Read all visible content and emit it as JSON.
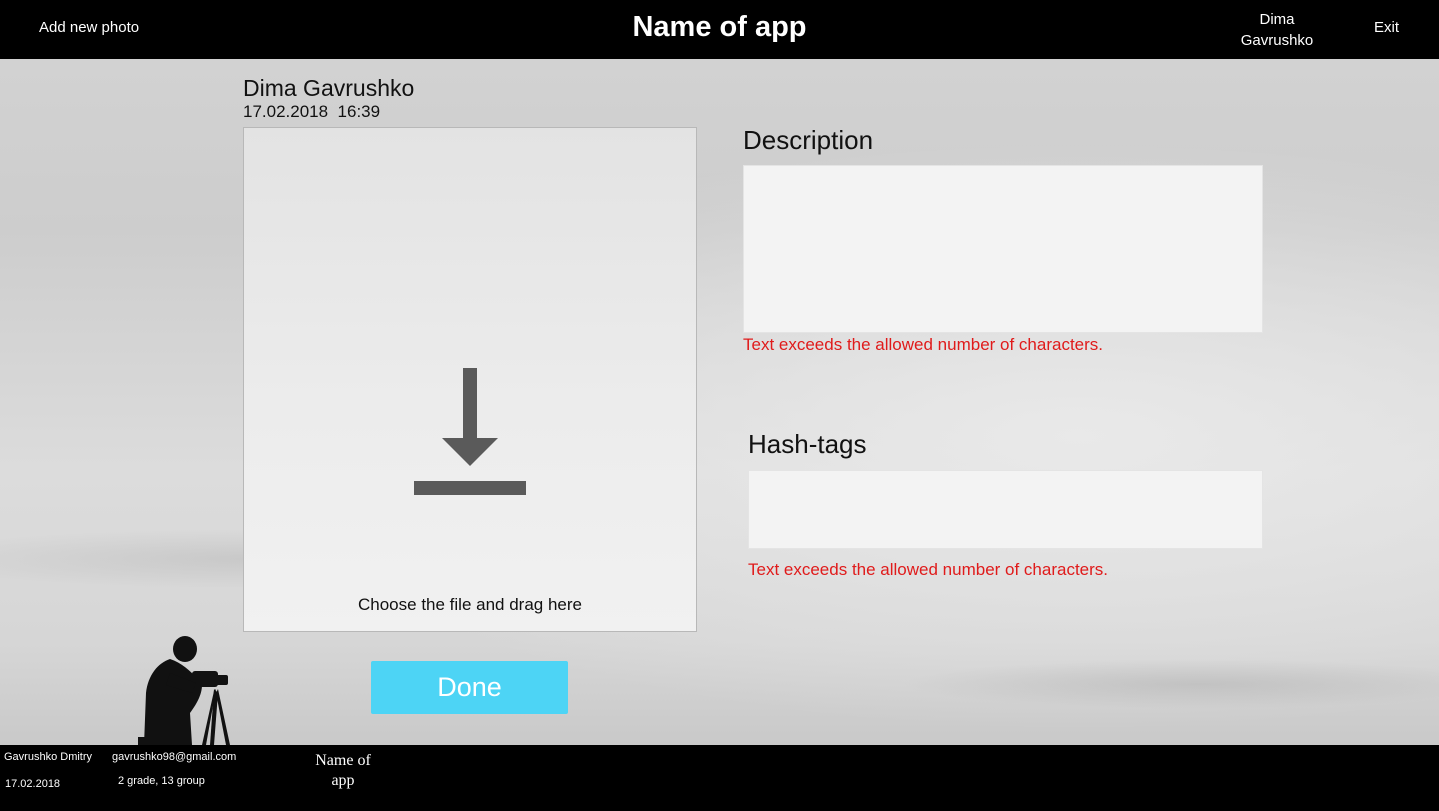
{
  "header": {
    "add_photo_label": "Add new photo",
    "app_title": "Name of app",
    "user_name_line1": "Dima",
    "user_name_line2": "Gavrushko",
    "exit_label": "Exit"
  },
  "post": {
    "author": "Dima Gavrushko",
    "date": "17.02.2018  16:39"
  },
  "upload": {
    "icon": "download-icon",
    "drop_label": "Choose the file and drag here"
  },
  "description": {
    "label": "Description",
    "value": "",
    "error": "Text exceeds the allowed number of characters."
  },
  "hashtags": {
    "label": "Hash-tags",
    "value": "",
    "error": "Text exceeds the allowed number of characters."
  },
  "done_label": "Done",
  "footer": {
    "author_name": "Gavrushko Dmitry",
    "email": "gavrushko98@gmail.com",
    "date": "17.02.2018",
    "group": "2 grade, 13 group",
    "app_line1": "Name of",
    "app_line2": "app"
  },
  "colors": {
    "header_bg": "#000000",
    "done_button": "#4dd4f5",
    "error_text": "#e01b1b",
    "icon": "#5a5a5a"
  }
}
